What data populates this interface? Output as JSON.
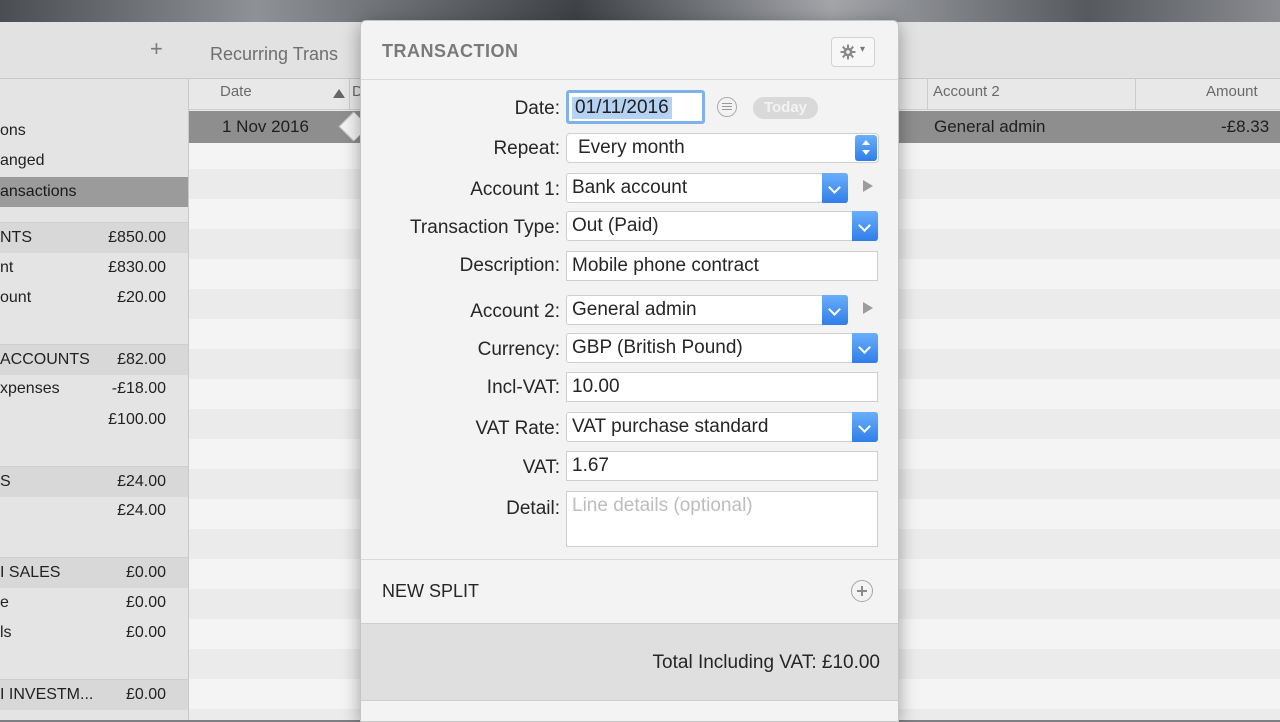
{
  "toolbar": {
    "add_symbol": "+",
    "tab_title": "Recurring Trans"
  },
  "sidebar": {
    "rows": [
      {
        "label": "ons",
        "value": ""
      },
      {
        "label": "anged",
        "value": ""
      },
      {
        "label": "ansactions",
        "value": "",
        "selected": true
      },
      {
        "label": "NTS",
        "value": "£850.00",
        "group": true
      },
      {
        "label": "nt",
        "value": "£830.00"
      },
      {
        "label": "ount",
        "value": "£20.00"
      },
      {
        "label": "ACCOUNTS",
        "value": "£82.00",
        "group": true
      },
      {
        "label": "xpenses",
        "value": "-£18.00"
      },
      {
        "label": "",
        "value": "£100.00"
      },
      {
        "label": "S",
        "value": "£24.00",
        "group": true
      },
      {
        "label": "",
        "value": "£24.00"
      },
      {
        "label": "I SALES",
        "value": "£0.00",
        "group": true
      },
      {
        "label": "e",
        "value": "£0.00"
      },
      {
        "label": "ls",
        "value": "£0.00"
      },
      {
        "label": "I INVESTM...",
        "value": "£0.00",
        "group": true
      }
    ]
  },
  "table": {
    "headers": {
      "date": "Date",
      "d": "D",
      "account2": "Account 2",
      "amount": "Amount"
    },
    "row": {
      "date": "1 Nov 2016",
      "account2": "General admin",
      "amount": "-£8.33"
    }
  },
  "popover": {
    "title": "TRANSACTION",
    "date_label": "Date:",
    "date_value": "01/11/2016",
    "today_label": "Today",
    "repeat_label": "Repeat:",
    "repeat_value": "Every month",
    "account1_label": "Account 1:",
    "account1_value": "Bank account",
    "type_label": "Transaction Type:",
    "type_value": "Out (Paid)",
    "description_label": "Description:",
    "description_value": "Mobile phone contract",
    "account2_label": "Account 2:",
    "account2_value": "General admin",
    "currency_label": "Currency:",
    "currency_value": "GBP (British Pound)",
    "inclvat_label": "Incl-VAT:",
    "inclvat_value": "10.00",
    "vatrate_label": "VAT Rate:",
    "vatrate_value": "VAT purchase standard",
    "vat_label": "VAT:",
    "vat_value": "1.67",
    "detail_label": "Detail:",
    "detail_placeholder": "Line details (optional)",
    "new_split_label": "NEW SPLIT",
    "total_text": "Total Including VAT: £10.00"
  },
  "colors": {
    "accent": "#3a8bf0",
    "selection": "#b5d2f3"
  }
}
